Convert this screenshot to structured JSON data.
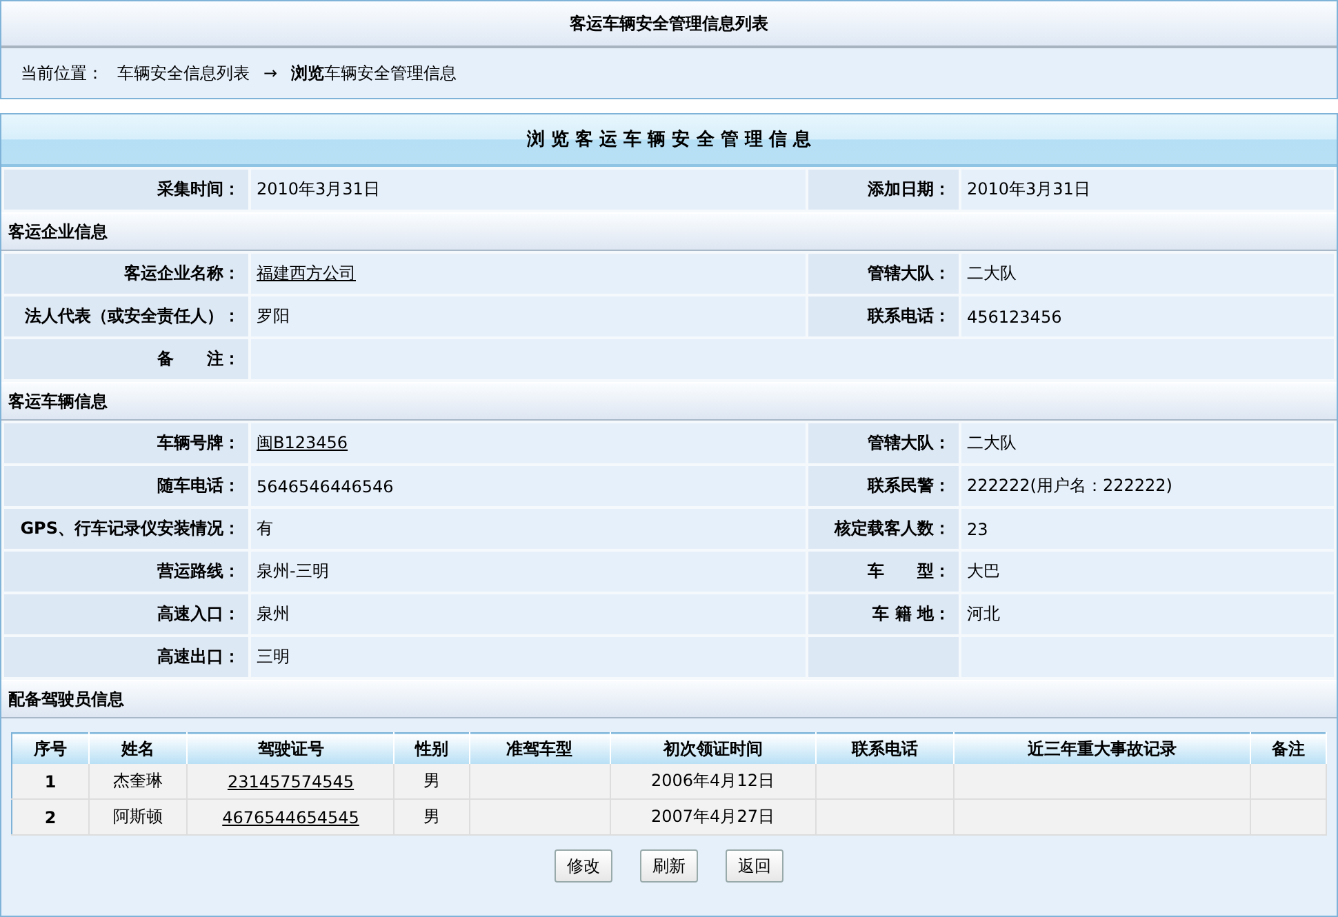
{
  "list_title": "客运车辆安全管理信息列表",
  "breadcrumb": {
    "prefix": "当前位置：",
    "link": "车辆安全信息列表",
    "arrow": "→",
    "current": "**浏览**车辆安全管理信息"
  },
  "panel_title": "浏 览 客 运 车 辆 安 全 管 理 信 息",
  "sections": [
    {
      "rows": [
        {
          "kind": "pair",
          "fields": [
            {
              "label": "采集时间：",
              "value": "2010年3月31日"
            },
            {
              "label": "添加日期：",
              "value": "2010年3月31日"
            }
          ]
        }
      ]
    },
    {
      "heading": "客运企业信息",
      "rows": [
        {
          "kind": "pair",
          "fields": [
            {
              "label": "客运企业名称：",
              "value": "福建西方公司",
              "link": true
            },
            {
              "label": "管辖大队：",
              "value": "二大队"
            }
          ]
        },
        {
          "kind": "pair",
          "fields": [
            {
              "label": "法人代表（或安全责任人）：",
              "value": "罗阳"
            },
            {
              "label": "联系电话：",
              "value": "456123456"
            }
          ]
        },
        {
          "kind": "wide",
          "fields": [
            {
              "label": "备　　注："
            }
          ]
        }
      ]
    },
    {
      "heading": "客运车辆信息",
      "rows": [
        {
          "kind": "pair",
          "fields": [
            {
              "label": "车辆号牌：",
              "value": "闽B123456",
              "link": true
            },
            {
              "label": "管辖大队：",
              "value": "二大队"
            }
          ]
        },
        {
          "kind": "pair",
          "fields": [
            {
              "label": "随车电话：",
              "value": "5646546446546"
            },
            {
              "label": "联系民警：",
              "value": "222222(用户名：222222)"
            }
          ]
        },
        {
          "kind": "pair",
          "fields": [
            {
              "label": "GPS、行车记录仪安装情况：",
              "value": "有"
            },
            {
              "label": "核定载客人数：",
              "value": "23"
            }
          ]
        },
        {
          "kind": "pair",
          "fields": [
            {
              "label": "营运路线：",
              "value": "泉州-三明"
            },
            {
              "label": "车　　型：",
              "value": "大巴"
            }
          ]
        },
        {
          "kind": "pair",
          "fields": [
            {
              "label": "高速入口：",
              "value": "泉州"
            },
            {
              "label": "车 籍 地：",
              "value": "河北"
            }
          ]
        },
        {
          "kind": "pair",
          "fields": [
            {
              "label": "高速出口：",
              "value": "三明"
            }
          ]
        }
      ]
    }
  ],
  "drivers": {
    "heading": "配备驾驶员信息",
    "columns": [
      "序号",
      "姓名",
      "驾驶证号",
      "性别",
      "准驾车型",
      "初次领证时间",
      "联系电话",
      "近三年重大事故记录",
      "备注"
    ],
    "rows": [
      {
        "cells": [
          "1",
          "杰奎琳",
          "231457574545",
          "男",
          "",
          "2006年4月12日",
          "",
          "",
          ""
        ]
      },
      {
        "cells": [
          "2",
          "阿斯顿",
          "4676544654545",
          "男",
          "",
          "2007年4月27日",
          "",
          "",
          ""
        ]
      }
    ]
  },
  "buttons": [
    "修改",
    "刷新",
    "返回"
  ]
}
